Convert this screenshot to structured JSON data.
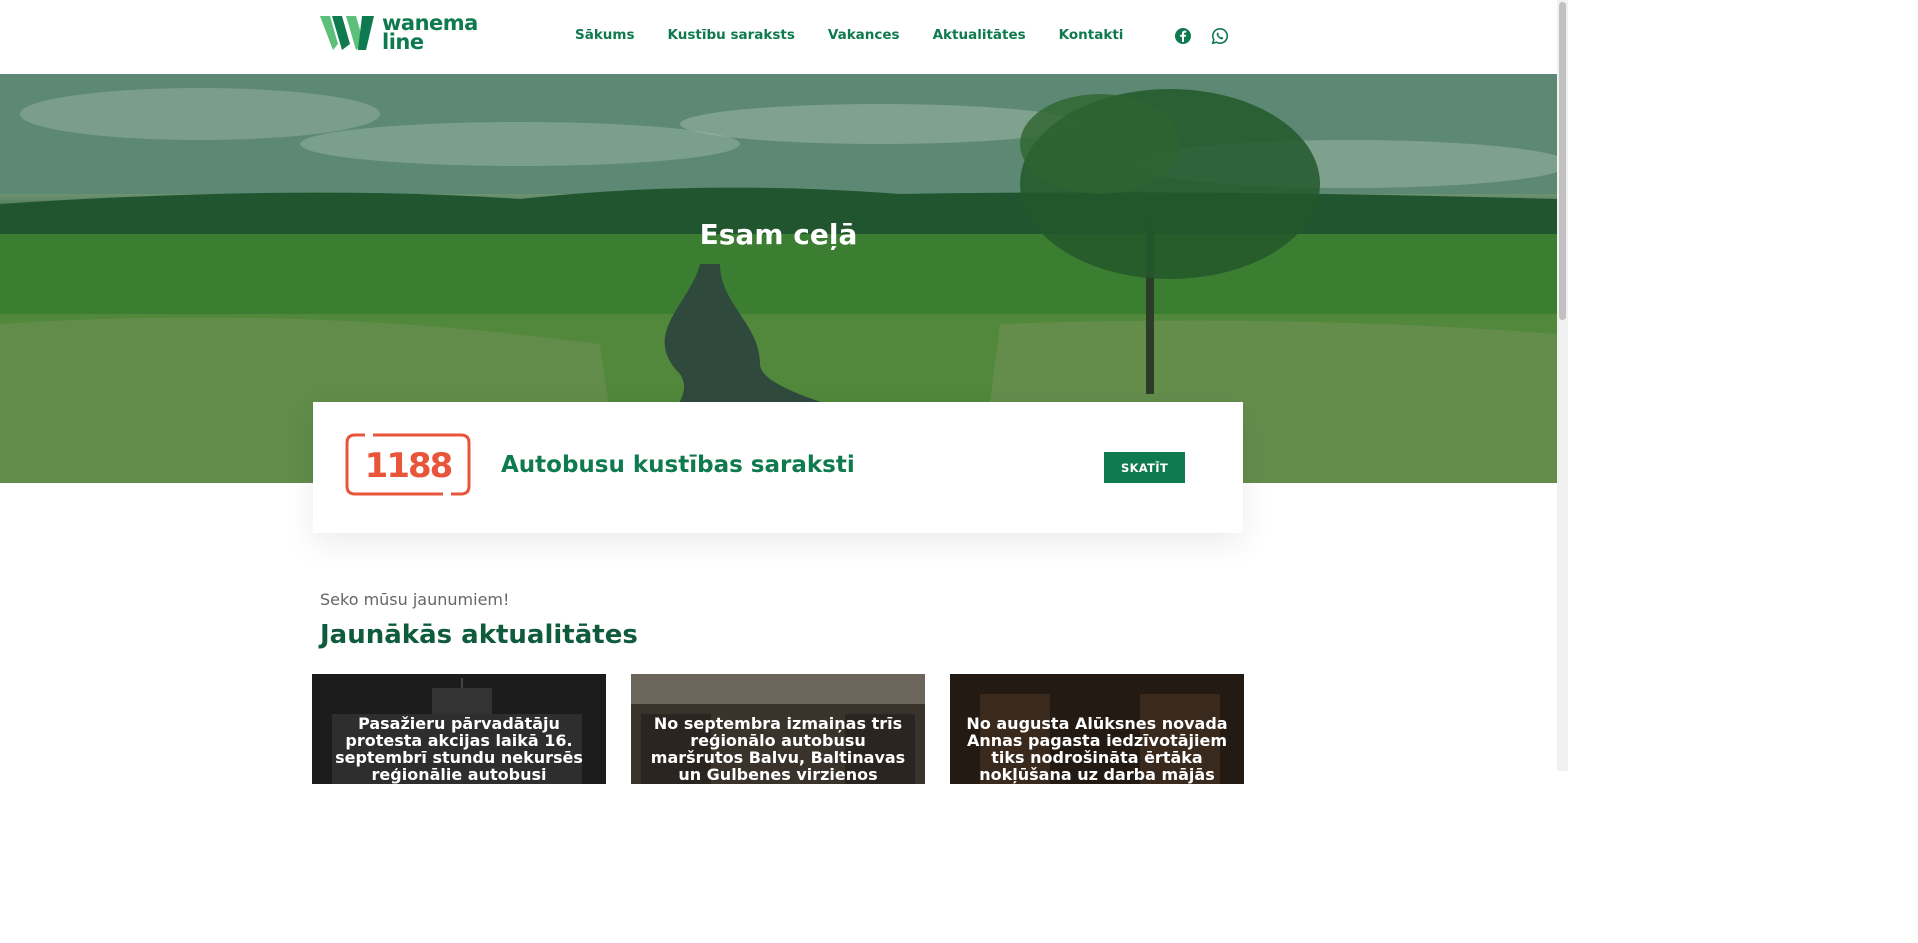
{
  "brand": {
    "name_line1": "wanema",
    "name_line2": "line",
    "color": "#0f7a4f"
  },
  "nav": {
    "items": [
      {
        "label": "Sākums"
      },
      {
        "label": "Kustību saraksts"
      },
      {
        "label": "Vakances"
      },
      {
        "label": "Aktualitātes"
      },
      {
        "label": "Kontakti"
      }
    ]
  },
  "social": {
    "icons": [
      "facebook-icon",
      "whatsapp-icon"
    ]
  },
  "hero": {
    "title": "Esam ceļā"
  },
  "timetable_card": {
    "badge": "1188",
    "badge_color": "#e8553a",
    "title": "Autobusu kustības saraksti",
    "button_label": "SKATĪT"
  },
  "news": {
    "subtitle": "Seko mūsu jaunumiem!",
    "heading": "Jaunākās aktualitātes",
    "cards": [
      {
        "title": "Pasažieru pārvadātāju protesta akcijas laikā 16. septembrī stundu nekursēs reģionālie autobusi"
      },
      {
        "title": "No septembra izmaiņas trīs reģionālo autobusu maršrutos Balvu, Baltinavas un Gulbenes virzienos"
      },
      {
        "title": "No augusta Alūksnes novada Annas pagasta iedzīvotājiem tiks nodrošināta ērtāka nokļūšana uz darba mājās"
      }
    ]
  }
}
